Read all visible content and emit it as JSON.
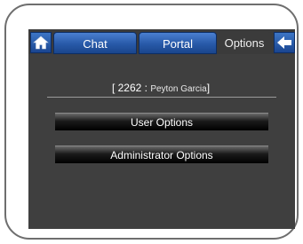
{
  "tabs": [
    {
      "label": "Chat"
    },
    {
      "label": "Portal"
    },
    {
      "label": "Options"
    }
  ],
  "user": {
    "id": "2262",
    "separator": " : ",
    "name": "Peyton Garcia",
    "open_bracket": "[ ",
    "close_bracket": "]"
  },
  "menu": {
    "user_options": "User Options",
    "admin_options": "Administrator Options"
  },
  "icons": {
    "home": "home-icon",
    "back": "back-arrow-icon"
  },
  "colors": {
    "tab_blue": "#2859a8",
    "background": "#3f3f3f"
  }
}
